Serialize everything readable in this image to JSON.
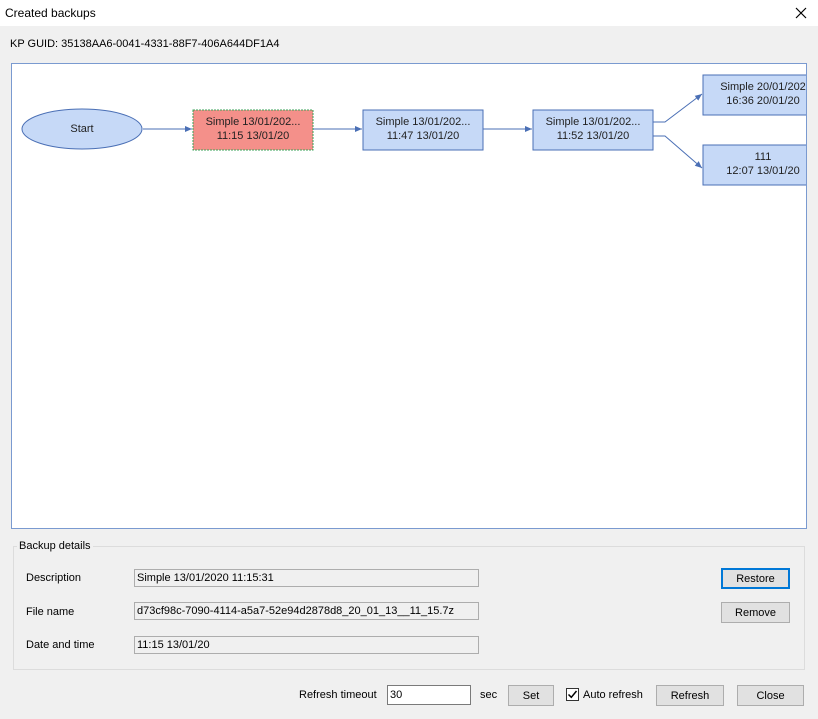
{
  "window": {
    "title": "Created backups"
  },
  "guid": {
    "text": "KP GUID: 35138AA6-0041-4331-88F7-406A644DF1A4"
  },
  "graph": {
    "nodes": [
      {
        "id": "start",
        "line1": "Start",
        "line2": ""
      },
      {
        "id": "n1",
        "line1": "Simple 13/01/202...",
        "line2": "11:15 13/01/20"
      },
      {
        "id": "n2",
        "line1": "Simple 13/01/202...",
        "line2": "11:47 13/01/20"
      },
      {
        "id": "n3",
        "line1": "Simple 13/01/202...",
        "line2": "11:52 13/01/20"
      },
      {
        "id": "n4",
        "line1": "Simple 20/01/202",
        "line2": "16:36 20/01/20"
      },
      {
        "id": "n5",
        "line1": "111",
        "line2": "12:07 13/01/20"
      }
    ],
    "colors": {
      "node": "#c6d9f7",
      "selected": "#f4908a",
      "edge": "#4a6fb5"
    }
  },
  "details": {
    "group_label": "Backup details",
    "description_label": "Description",
    "description_value": "Simple 13/01/2020 11:15:31",
    "filename_label": "File name",
    "filename_value": "d73cf98c-7090-4114-a5a7-52e94d2878d8_20_01_13__11_15.7z",
    "datetime_label": "Date and time",
    "datetime_value": "11:15 13/01/20",
    "restore_label": "Restore",
    "remove_label": "Remove"
  },
  "footer": {
    "refresh_timeout_label": "Refresh timeout",
    "refresh_timeout_value": "30",
    "sec_label": "sec",
    "set_label": "Set",
    "auto_refresh_label": "Auto refresh",
    "auto_refresh_checked": true,
    "refresh_label": "Refresh",
    "close_label": "Close"
  }
}
